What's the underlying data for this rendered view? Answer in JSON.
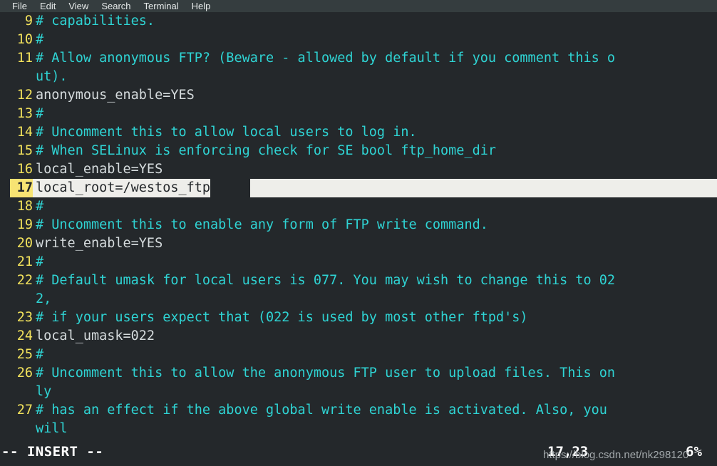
{
  "window": {
    "app": "vim-terminal",
    "title": "Terminal"
  },
  "colors": {
    "background": "#24282b",
    "menubar": "#353d3f",
    "comment": "#2fd4d4",
    "code_text": "#d5dbdd",
    "line_number": "#f2e25c",
    "cursor_line_number_bg": "#f7e373",
    "selection_bg": "#eeeeea",
    "selection_fg": "#24282b",
    "status_text": "#ffffff"
  },
  "menubar": {
    "items": [
      {
        "label": "File"
      },
      {
        "label": "Edit"
      },
      {
        "label": "View"
      },
      {
        "label": "Search"
      },
      {
        "label": "Terminal"
      },
      {
        "label": "Help"
      }
    ]
  },
  "editor": {
    "lines": [
      {
        "number": "9",
        "kind": "comment",
        "segments": [
          "# capabilities."
        ],
        "current": false
      },
      {
        "number": "10",
        "kind": "comment",
        "segments": [
          "#"
        ],
        "current": false
      },
      {
        "number": "11",
        "kind": "comment",
        "segments": [
          "# Allow anonymous FTP? (Beware - allowed by default if you comment this o",
          "ut)."
        ],
        "current": false
      },
      {
        "number": "12",
        "kind": "code",
        "segments": [
          "anonymous_enable=YES"
        ],
        "current": false
      },
      {
        "number": "13",
        "kind": "comment",
        "segments": [
          "#"
        ],
        "current": false
      },
      {
        "number": "14",
        "kind": "comment",
        "segments": [
          "# Uncomment this to allow local users to log in."
        ],
        "current": false
      },
      {
        "number": "15",
        "kind": "comment",
        "segments": [
          "# When SELinux is enforcing check for SE bool ftp_home_dir"
        ],
        "current": false
      },
      {
        "number": "16",
        "kind": "code",
        "segments": [
          "local_enable=YES"
        ],
        "current": false
      },
      {
        "number": "17",
        "kind": "code",
        "segments": [
          "local_root=/westos_ftp"
        ],
        "current": true,
        "selected": true
      },
      {
        "number": "18",
        "kind": "comment",
        "segments": [
          "#"
        ],
        "current": false
      },
      {
        "number": "19",
        "kind": "comment",
        "segments": [
          "# Uncomment this to enable any form of FTP write command."
        ],
        "current": false
      },
      {
        "number": "20",
        "kind": "code",
        "segments": [
          "write_enable=YES"
        ],
        "current": false
      },
      {
        "number": "21",
        "kind": "comment",
        "segments": [
          "#"
        ],
        "current": false
      },
      {
        "number": "22",
        "kind": "comment",
        "segments": [
          "# Default umask for local users is 077. You may wish to change this to 02",
          "2,"
        ],
        "current": false
      },
      {
        "number": "23",
        "kind": "comment",
        "segments": [
          "# if your users expect that (022 is used by most other ftpd's)"
        ],
        "current": false
      },
      {
        "number": "24",
        "kind": "code",
        "segments": [
          "local_umask=022"
        ],
        "current": false
      },
      {
        "number": "25",
        "kind": "comment",
        "segments": [
          "#"
        ],
        "current": false
      },
      {
        "number": "26",
        "kind": "comment",
        "segments": [
          "# Uncomment this to allow the anonymous FTP user to upload files. This on",
          "ly"
        ],
        "current": false
      },
      {
        "number": "27",
        "kind": "comment",
        "segments": [
          "# has an effect if the above global write enable is activated. Also, you",
          "will"
        ],
        "current": false
      }
    ]
  },
  "statusline": {
    "mode": "-- INSERT --",
    "cursor_position": "17,23",
    "scroll_percent": "6%"
  },
  "watermark": {
    "text": "https://blog.csdn.net/nk298120"
  }
}
